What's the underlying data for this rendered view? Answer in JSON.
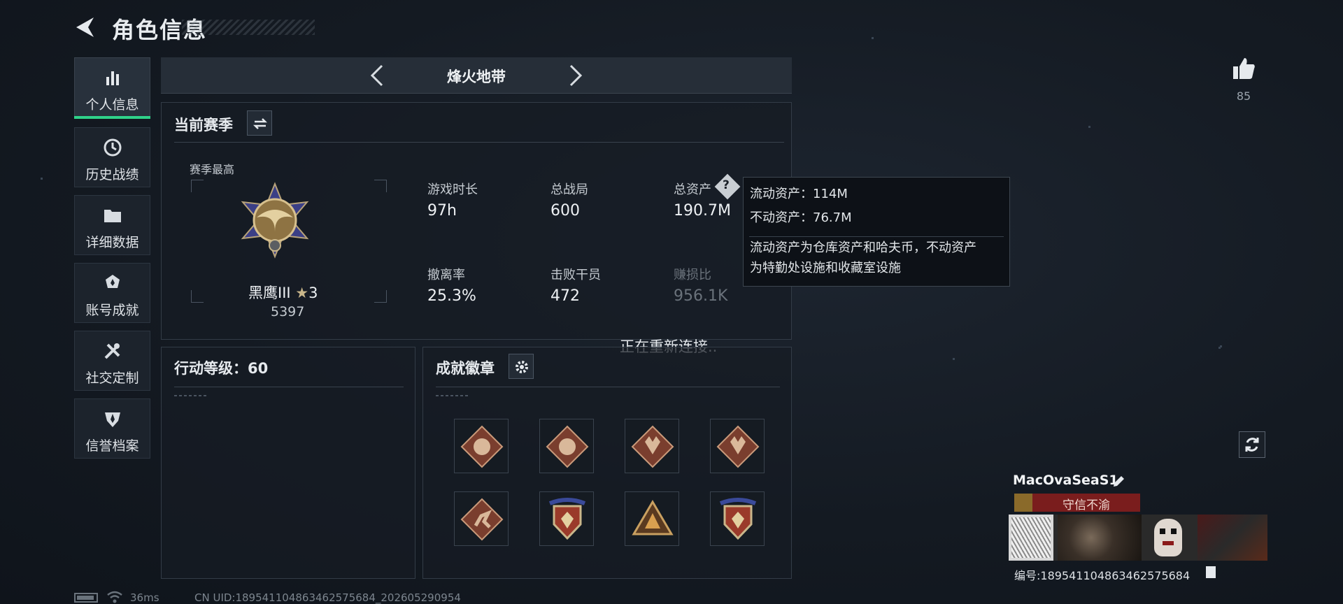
{
  "header": {
    "title": "角色信息"
  },
  "sidebar": {
    "items": [
      {
        "label": "个人信息",
        "icon": "bar-chart-icon",
        "active": true
      },
      {
        "label": "历史战绩",
        "icon": "history-clock-icon",
        "active": false
      },
      {
        "label": "详细数据",
        "icon": "folder-icon",
        "active": false
      },
      {
        "label": "账号成就",
        "icon": "achievement-icon",
        "active": false
      },
      {
        "label": "社交定制",
        "icon": "tools-icon",
        "active": false
      },
      {
        "label": "信誉档案",
        "icon": "shield-icon",
        "active": false
      }
    ]
  },
  "season_selector": {
    "name": "烽火地带"
  },
  "current_season": {
    "title": "当前赛季",
    "season_best_label": "赛季最高",
    "rank_name": "黑鹰III",
    "rank_stars": "3",
    "rank_score": "5397",
    "stats": [
      {
        "label": "游戏时长",
        "value": "97h"
      },
      {
        "label": "总战局",
        "value": "600"
      },
      {
        "label": "总资产",
        "value": "190.7M"
      },
      {
        "label": "撤离率",
        "value": "25.3%"
      },
      {
        "label": "击败干员",
        "value": "472"
      },
      {
        "label": "赚损比",
        "value": "956.1K"
      }
    ]
  },
  "tooltip": {
    "liquid": "流动资产：114M",
    "fixed": "不动资产：76.7M",
    "desc_line1": "流动资产为仓库资产和哈夫币，不动资产",
    "desc_line2": "为特勤处设施和收藏室设施"
  },
  "reconnect_text": "正在重新连接..",
  "action_level": {
    "title": "行动等级：60"
  },
  "achievements": {
    "title": "成就徽章",
    "badges": [
      "dragon-badge-icon",
      "dragon-badge-icon",
      "wolf-badge-icon",
      "wolf-badge-icon",
      "runner-badge-icon",
      "crest-badge-icon",
      "triangle-badge-icon",
      "crest-badge-icon"
    ]
  },
  "profile": {
    "likes": "85",
    "player_name": "MacOvaSeaS1",
    "player_title": "守信不渝",
    "player_id": "编号:1895411048634625756​84"
  },
  "status_bar": {
    "ping": "36ms",
    "uid": "CN UID:18954110486346257568​4_202605290954"
  },
  "colors": {
    "accent": "#2fd28a",
    "title_badge": "#7a1d1d",
    "tooltip_bg": "#0d1117"
  }
}
